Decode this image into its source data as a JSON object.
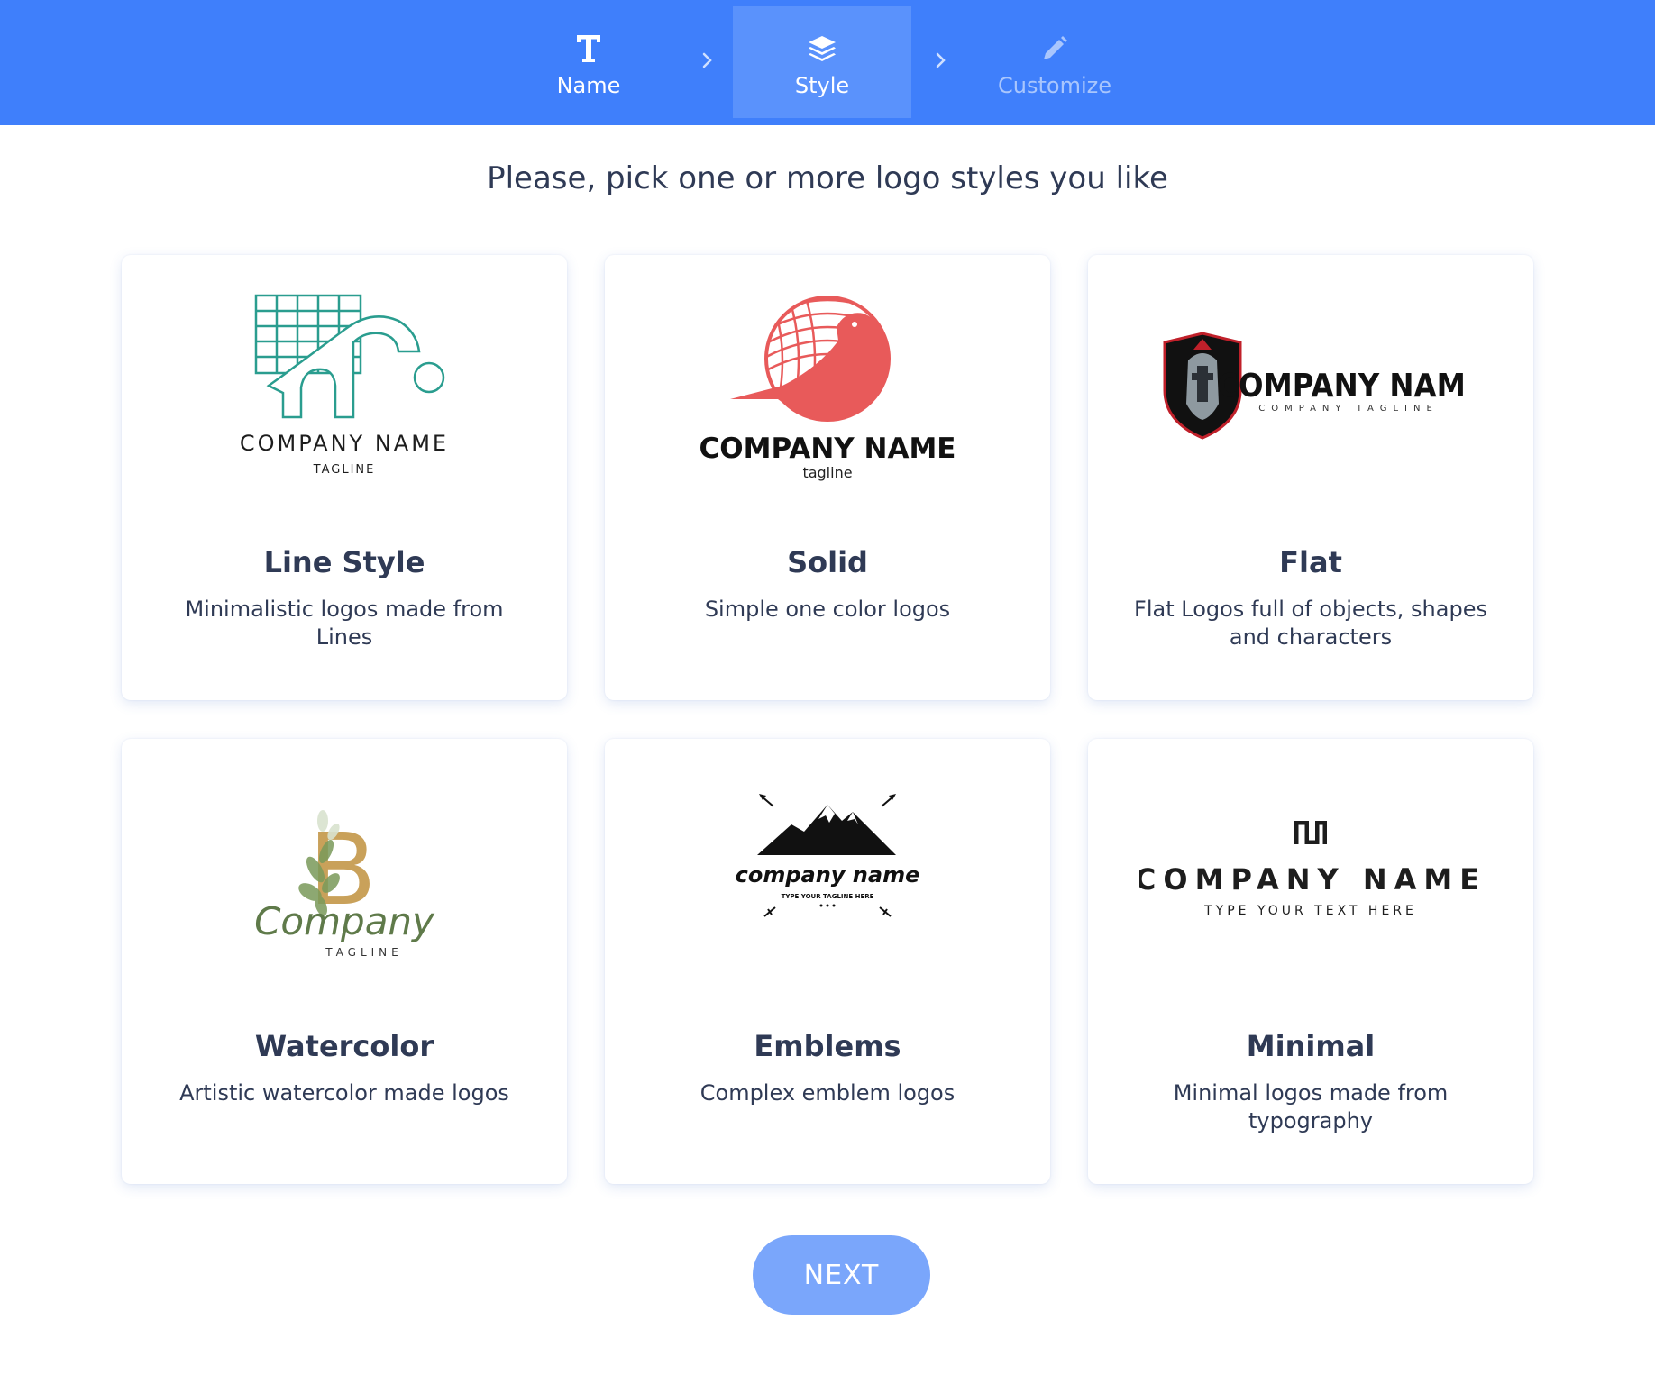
{
  "steps": [
    {
      "label": "Name",
      "icon": "text-t-icon",
      "state": "done"
    },
    {
      "label": "Style",
      "icon": "layers-icon",
      "state": "active"
    },
    {
      "label": "Customize",
      "icon": "pencil-icon",
      "state": "upcoming"
    }
  ],
  "heading": "Please, pick one or more logo styles you like",
  "cards": [
    {
      "title": "Line Style",
      "description": "Minimalistic logos made from Lines",
      "sample": {
        "name": "COMPANY NAME",
        "tagline": "TAGLINE"
      }
    },
    {
      "title": "Solid",
      "description": "Simple one color logos",
      "sample": {
        "name": "COMPANY NAME",
        "tagline": "tagline"
      }
    },
    {
      "title": "Flat",
      "description": "Flat Logos full of objects, shapes and characters",
      "sample": {
        "name": "COMPANY NAME",
        "tagline": "COMPANY TAGLINE"
      }
    },
    {
      "title": "Watercolor",
      "description": "Artistic watercolor made logos",
      "sample": {
        "letter": "B",
        "name": "Company",
        "tagline": "TAGLINE"
      }
    },
    {
      "title": "Emblems",
      "description": "Complex emblem logos",
      "sample": {
        "name": "company name",
        "tagline": "TYPE YOUR TAGLINE HERE"
      }
    },
    {
      "title": "Minimal",
      "description": "Minimal logos made from typography",
      "sample": {
        "name": "COMPANY NAME",
        "tagline": "TYPE YOUR TEXT HERE"
      }
    }
  ],
  "next_button": "NEXT",
  "colors": {
    "header": "#3f7ffb",
    "active_step": "#5a92fc",
    "text": "#2f3a55",
    "next_button": "#7aa6fb",
    "line_logo": "#2a9d8f",
    "solid_logo": "#e85a5a"
  }
}
